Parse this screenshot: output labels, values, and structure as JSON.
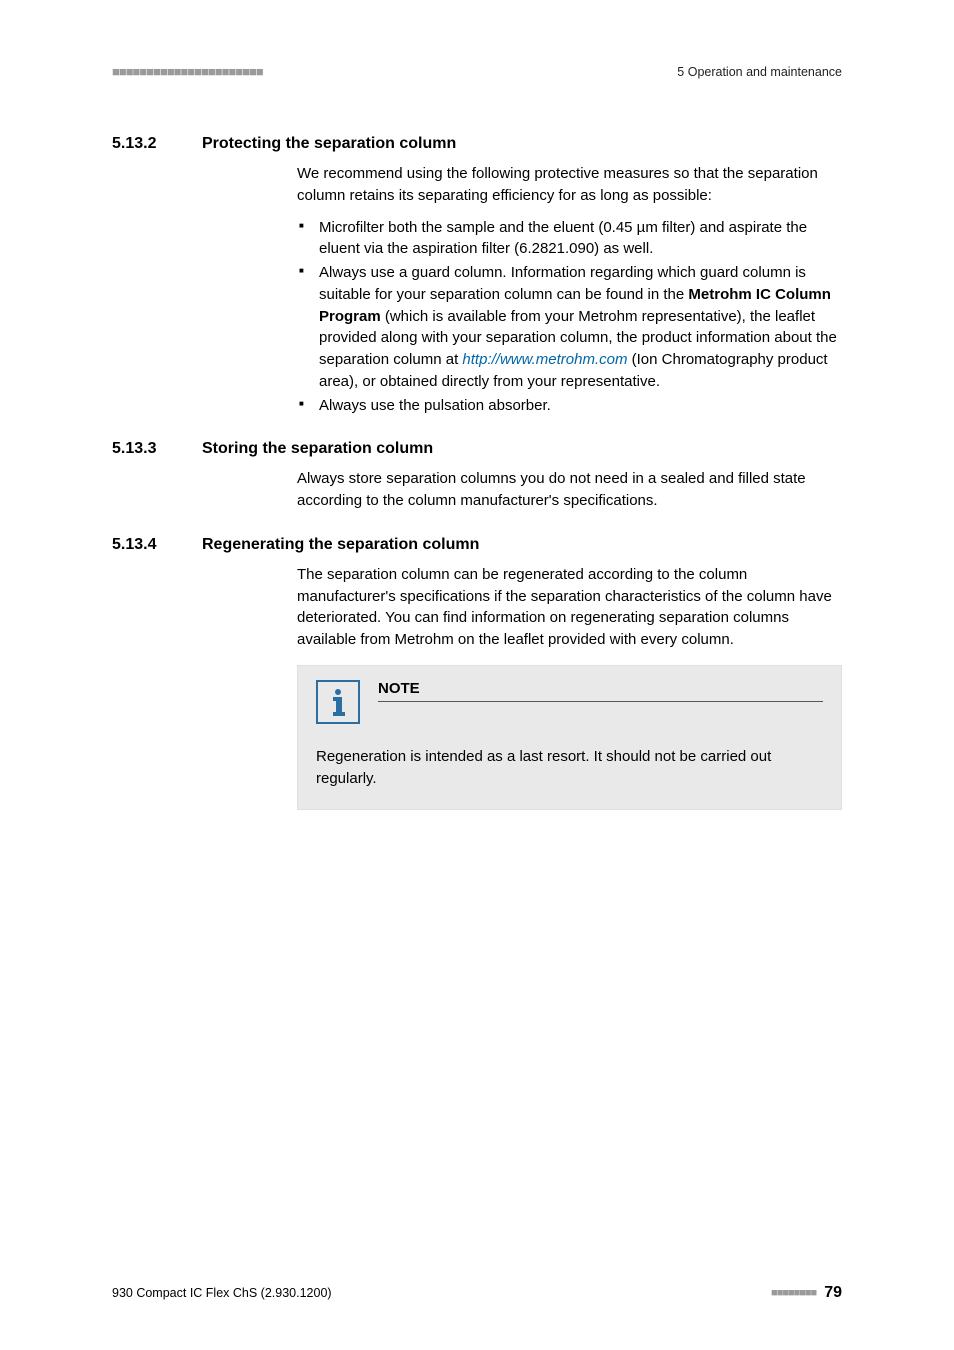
{
  "header": {
    "left_dashes": "■■■■■■■■■■■■■■■■■■■■■■",
    "right_text": "5 Operation and maintenance"
  },
  "sections": [
    {
      "num": "5.13.2",
      "title": "Protecting the separation column",
      "intro": "We recommend using the following protective measures so that the separation column retains its separating efficiency for as long as possible:",
      "bullets": [
        {
          "pre": "Microfilter both the sample and the eluent (0.45 µm filter) and aspirate the eluent via the aspiration filter (6.2821.090) as well."
        },
        {
          "pre": "Always use a guard column. Information regarding which guard column is suitable for your separation column can be found in the ",
          "bold": "Metrohm IC Column Program",
          "mid": " (which is available from your Metrohm representative), the leaflet provided along with your separation column, the product information about the separation column at ",
          "link": "http://www.metrohm.com",
          "post": " (Ion Chromatography product area), or obtained directly from your representative."
        },
        {
          "pre": "Always use the pulsation absorber."
        }
      ]
    },
    {
      "num": "5.13.3",
      "title": "Storing the separation column",
      "body": "Always store separation columns you do not need in a sealed and filled state according to the column manufacturer's specifications."
    },
    {
      "num": "5.13.4",
      "title": "Regenerating the separation column",
      "body": "The separation column can be regenerated according to the column manufacturer's specifications if the separation characteristics of the column have deteriorated. You can find information on regenerating separation columns available from Metrohm on the leaflet provided with every column."
    }
  ],
  "note": {
    "label": "NOTE",
    "text": "Regeneration is intended as a last resort. It should not be carried out regularly."
  },
  "footer": {
    "left": "930 Compact IC Flex ChS (2.930.1200)",
    "right_dashes": "■■■■■■■■",
    "page": "79"
  }
}
